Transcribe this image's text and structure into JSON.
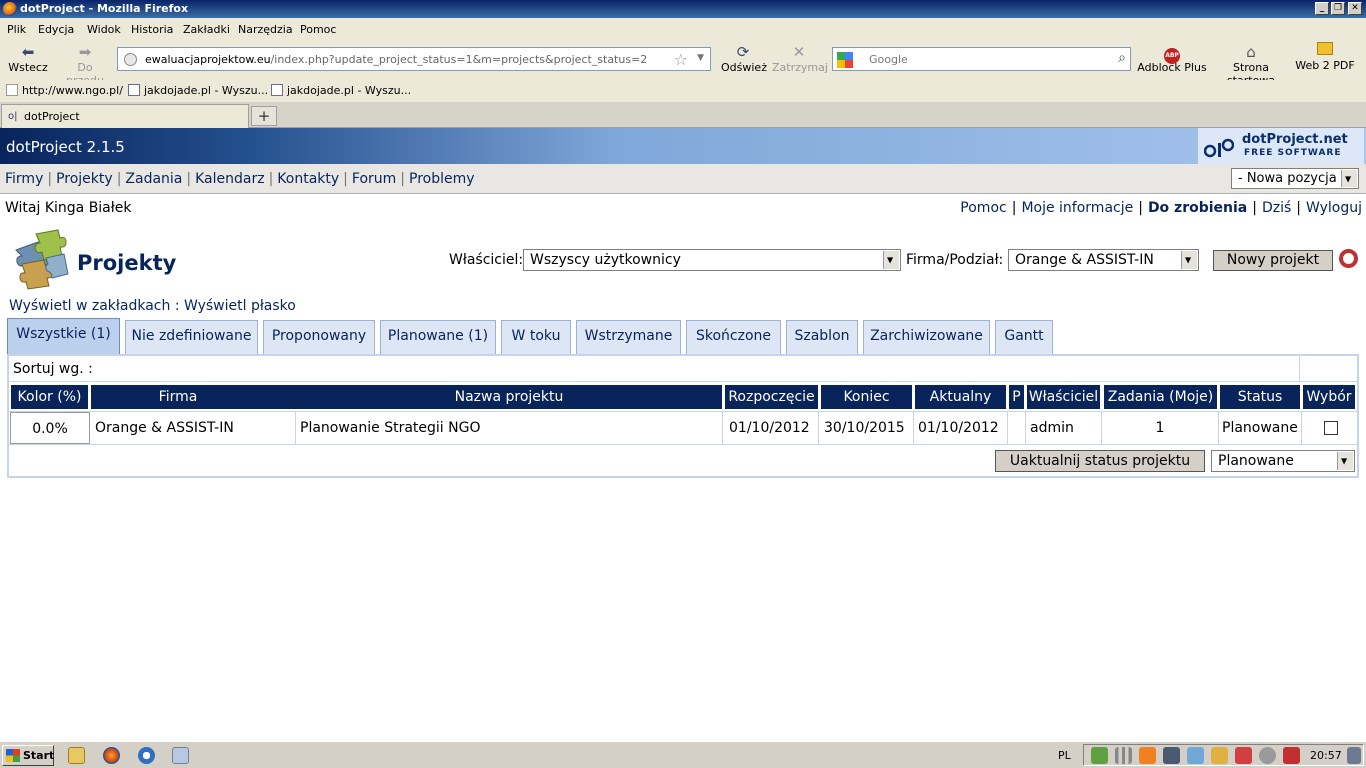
{
  "browser": {
    "window_title": "dotProject - Mozilla Firefox",
    "menu": [
      "Plik",
      "Edycja",
      "Widok",
      "Historia",
      "Zakładki",
      "Narzędzia",
      "Pomoc"
    ],
    "nav": {
      "back": "Wstecz",
      "forward": "Do przodu",
      "reload": "Odśwież",
      "stop": "Zatrzymaj",
      "adblock": "Adblock Plus",
      "home": "Strona startowa",
      "web2pdf": "Web 2 PDF"
    },
    "url_domain": "ewaluacjaprojektow.eu",
    "url_rest": "/index.php?update_project_status=1&m=projects&project_status=2",
    "search_placeholder": "Google",
    "bookmarks": [
      "http://www.ngo.pl/",
      "jakdojade.pl - Wyszu...",
      "jakdojade.pl - Wyszu..."
    ],
    "tab_label": "dotProject",
    "new_tab": "+"
  },
  "app": {
    "title": "dotProject 2.1.5",
    "logo_name": "dotProject.net",
    "logo_tagline": "FREE SOFTWARE",
    "nav": [
      "Firmy",
      "Projekty",
      "Zadania",
      "Kalendarz",
      "Kontakty",
      "Forum",
      "Problemy"
    ],
    "new_item_select": "- Nowa pozycja -",
    "welcome": "Witaj Kinga Białek",
    "top_links": [
      "Pomoc",
      "Moje informacje",
      "Do zrobienia",
      "Dziś",
      "Wyloguj"
    ]
  },
  "page": {
    "title": "Projekty",
    "owner_label": "Właściciel:",
    "owner_value": "Wszyscy użytkownicy",
    "company_label": "Firma/Podział:",
    "company_value": "Orange & ASSIST-IN",
    "new_project": "Nowy projekt",
    "view_tabs_link": "Wyświetl w zakładkach",
    "view_sep": ":",
    "view_flat_link": "Wyświetl płasko",
    "tabs": [
      "Wszystkie (1)",
      "Nie zdefiniowane",
      "Proponowany",
      "Planowane (1)",
      "W toku",
      "Wstrzymane",
      "Skończone",
      "Szablon",
      "Zarchiwizowane",
      "Gantt"
    ],
    "sort_label": "Sortuj wg. :",
    "columns": [
      "Kolor (%)",
      "Firma",
      "Nazwa projektu",
      "Rozpoczęcie",
      "Koniec",
      "Aktualny",
      "P",
      "Właściciel",
      "Zadania (Moje)",
      "Status",
      "Wybór"
    ],
    "rows": [
      {
        "color_pct": "0.0%",
        "company": "Orange & ASSIST-IN",
        "name": "Planowanie Strategii NGO",
        "start": "01/10/2012",
        "end": "30/10/2015",
        "actual": "01/10/2012",
        "priority": "",
        "owner": "admin",
        "tasks": "1",
        "status": "Planowane",
        "selected": false
      }
    ],
    "update_button": "Uaktualnij status projektu",
    "status_select": "Planowane"
  },
  "taskbar": {
    "start": "Start",
    "lang": "PL",
    "clock": "20:57"
  },
  "colors": {
    "header_dark": "#08245b",
    "header_light": "#a8c6ee",
    "tab_bg": "#dce6f4",
    "tab_active": "#bcd0ee",
    "link": "#08245b"
  }
}
